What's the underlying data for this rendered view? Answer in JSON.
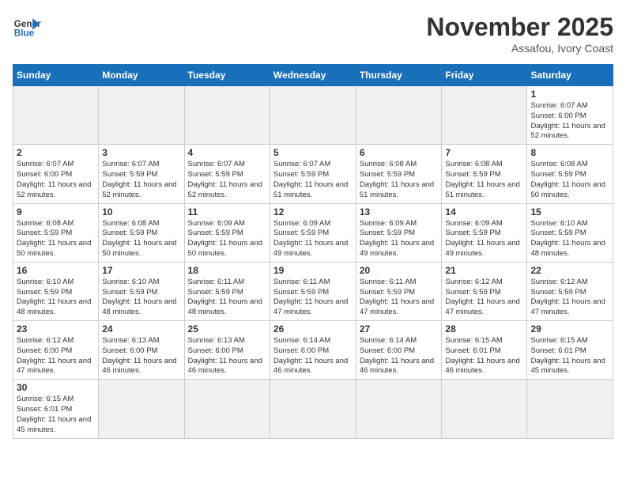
{
  "header": {
    "logo_general": "General",
    "logo_blue": "Blue",
    "month_title": "November 2025",
    "location": "Assafou, Ivory Coast"
  },
  "days_of_week": [
    "Sunday",
    "Monday",
    "Tuesday",
    "Wednesday",
    "Thursday",
    "Friday",
    "Saturday"
  ],
  "weeks": [
    [
      {
        "day": "",
        "info": ""
      },
      {
        "day": "",
        "info": ""
      },
      {
        "day": "",
        "info": ""
      },
      {
        "day": "",
        "info": ""
      },
      {
        "day": "",
        "info": ""
      },
      {
        "day": "",
        "info": ""
      },
      {
        "day": "1",
        "info": "Sunrise: 6:07 AM\nSunset: 6:00 PM\nDaylight: 11 hours and 52 minutes."
      }
    ],
    [
      {
        "day": "2",
        "info": "Sunrise: 6:07 AM\nSunset: 6:00 PM\nDaylight: 11 hours and 52 minutes."
      },
      {
        "day": "3",
        "info": "Sunrise: 6:07 AM\nSunset: 5:59 PM\nDaylight: 11 hours and 52 minutes."
      },
      {
        "day": "4",
        "info": "Sunrise: 6:07 AM\nSunset: 5:59 PM\nDaylight: 11 hours and 52 minutes."
      },
      {
        "day": "5",
        "info": "Sunrise: 6:07 AM\nSunset: 5:59 PM\nDaylight: 11 hours and 51 minutes."
      },
      {
        "day": "6",
        "info": "Sunrise: 6:08 AM\nSunset: 5:59 PM\nDaylight: 11 hours and 51 minutes."
      },
      {
        "day": "7",
        "info": "Sunrise: 6:08 AM\nSunset: 5:59 PM\nDaylight: 11 hours and 51 minutes."
      },
      {
        "day": "8",
        "info": "Sunrise: 6:08 AM\nSunset: 5:59 PM\nDaylight: 11 hours and 50 minutes."
      }
    ],
    [
      {
        "day": "9",
        "info": "Sunrise: 6:08 AM\nSunset: 5:59 PM\nDaylight: 11 hours and 50 minutes."
      },
      {
        "day": "10",
        "info": "Sunrise: 6:08 AM\nSunset: 5:59 PM\nDaylight: 11 hours and 50 minutes."
      },
      {
        "day": "11",
        "info": "Sunrise: 6:09 AM\nSunset: 5:59 PM\nDaylight: 11 hours and 50 minutes."
      },
      {
        "day": "12",
        "info": "Sunrise: 6:09 AM\nSunset: 5:59 PM\nDaylight: 11 hours and 49 minutes."
      },
      {
        "day": "13",
        "info": "Sunrise: 6:09 AM\nSunset: 5:59 PM\nDaylight: 11 hours and 49 minutes."
      },
      {
        "day": "14",
        "info": "Sunrise: 6:09 AM\nSunset: 5:59 PM\nDaylight: 11 hours and 49 minutes."
      },
      {
        "day": "15",
        "info": "Sunrise: 6:10 AM\nSunset: 5:59 PM\nDaylight: 11 hours and 48 minutes."
      }
    ],
    [
      {
        "day": "16",
        "info": "Sunrise: 6:10 AM\nSunset: 5:59 PM\nDaylight: 11 hours and 48 minutes."
      },
      {
        "day": "17",
        "info": "Sunrise: 6:10 AM\nSunset: 5:59 PM\nDaylight: 11 hours and 48 minutes."
      },
      {
        "day": "18",
        "info": "Sunrise: 6:11 AM\nSunset: 5:59 PM\nDaylight: 11 hours and 48 minutes."
      },
      {
        "day": "19",
        "info": "Sunrise: 6:11 AM\nSunset: 5:59 PM\nDaylight: 11 hours and 47 minutes."
      },
      {
        "day": "20",
        "info": "Sunrise: 6:11 AM\nSunset: 5:59 PM\nDaylight: 11 hours and 47 minutes."
      },
      {
        "day": "21",
        "info": "Sunrise: 6:12 AM\nSunset: 5:59 PM\nDaylight: 11 hours and 47 minutes."
      },
      {
        "day": "22",
        "info": "Sunrise: 6:12 AM\nSunset: 5:59 PM\nDaylight: 11 hours and 47 minutes."
      }
    ],
    [
      {
        "day": "23",
        "info": "Sunrise: 6:12 AM\nSunset: 6:00 PM\nDaylight: 11 hours and 47 minutes."
      },
      {
        "day": "24",
        "info": "Sunrise: 6:13 AM\nSunset: 6:00 PM\nDaylight: 11 hours and 46 minutes."
      },
      {
        "day": "25",
        "info": "Sunrise: 6:13 AM\nSunset: 6:00 PM\nDaylight: 11 hours and 46 minutes."
      },
      {
        "day": "26",
        "info": "Sunrise: 6:14 AM\nSunset: 6:00 PM\nDaylight: 11 hours and 46 minutes."
      },
      {
        "day": "27",
        "info": "Sunrise: 6:14 AM\nSunset: 6:00 PM\nDaylight: 11 hours and 46 minutes."
      },
      {
        "day": "28",
        "info": "Sunrise: 6:15 AM\nSunset: 6:01 PM\nDaylight: 11 hours and 46 minutes."
      },
      {
        "day": "29",
        "info": "Sunrise: 6:15 AM\nSunset: 6:01 PM\nDaylight: 11 hours and 45 minutes."
      }
    ],
    [
      {
        "day": "30",
        "info": "Sunrise: 6:15 AM\nSunset: 6:01 PM\nDaylight: 11 hours and 45 minutes."
      },
      {
        "day": "",
        "info": ""
      },
      {
        "day": "",
        "info": ""
      },
      {
        "day": "",
        "info": ""
      },
      {
        "day": "",
        "info": ""
      },
      {
        "day": "",
        "info": ""
      },
      {
        "day": "",
        "info": ""
      }
    ]
  ]
}
